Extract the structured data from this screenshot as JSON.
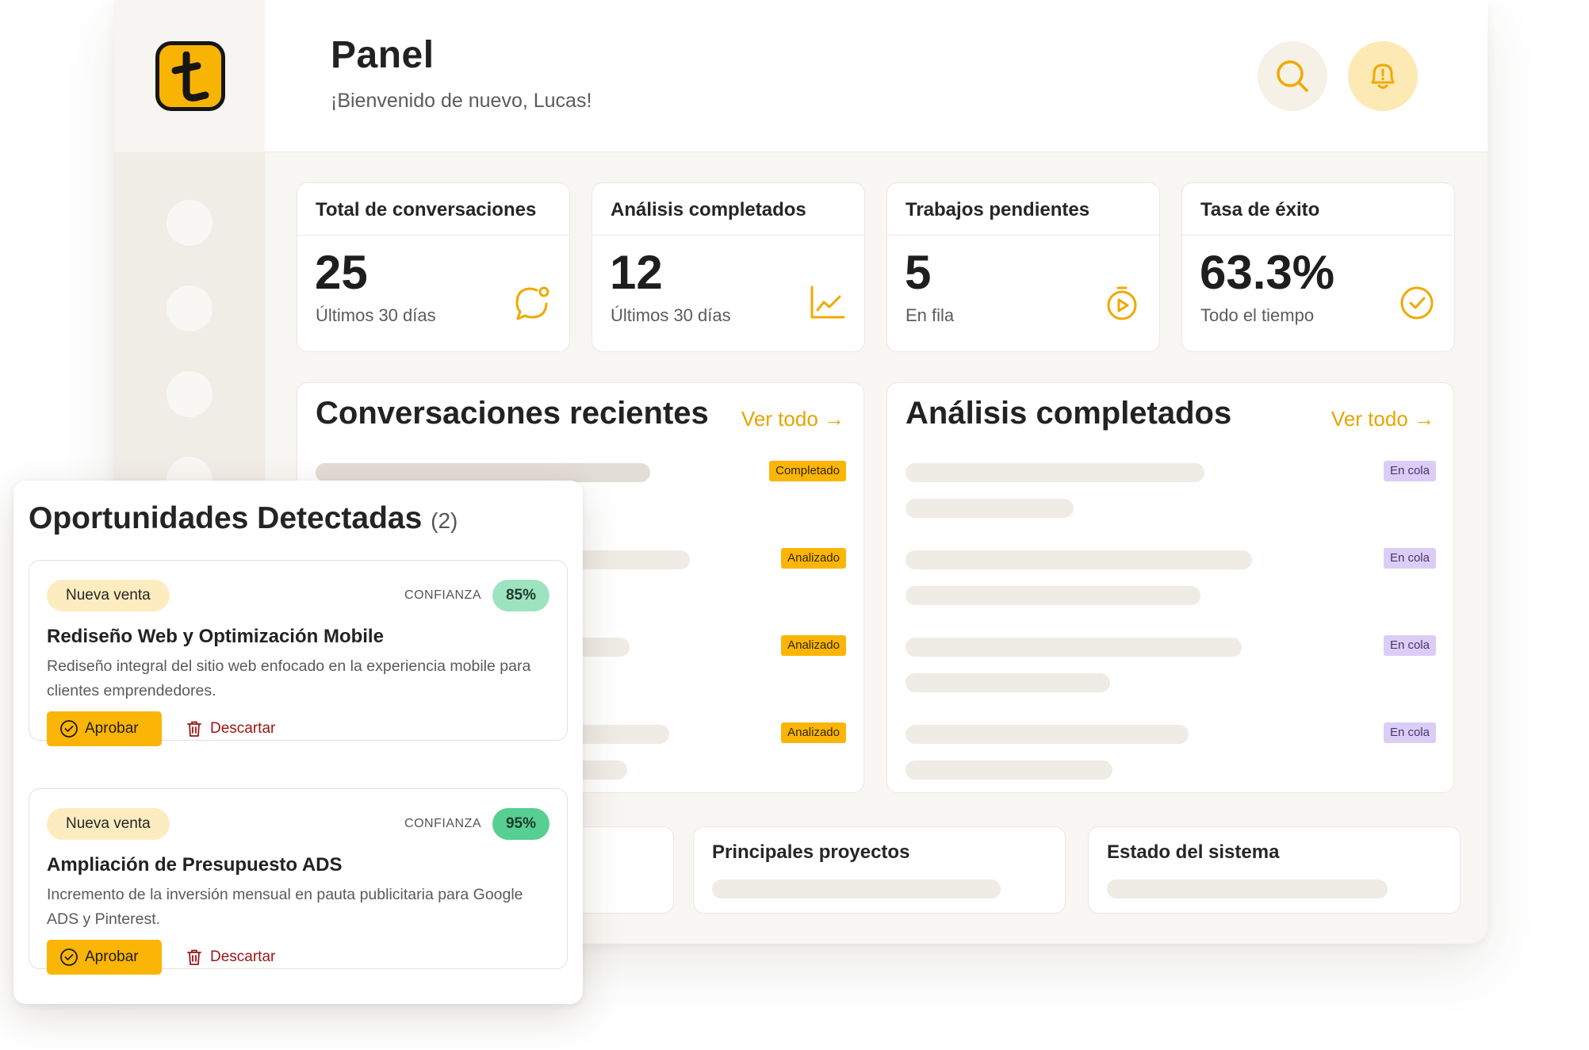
{
  "header": {
    "title": "Panel",
    "subtitle": "¡Bienvenido de nuevo, Lucas!",
    "search_icon": "search-icon",
    "bell_icon": "bell-icon"
  },
  "stats": [
    {
      "label": "Total de conversaciones",
      "value": "25",
      "sub": "Últimos 30 días",
      "icon": "chat-icon"
    },
    {
      "label": "Análisis completados",
      "value": "12",
      "sub": "Últimos 30 días",
      "icon": "chart-icon"
    },
    {
      "label": "Trabajos pendientes",
      "value": "5",
      "sub": "En fila",
      "icon": "timer-icon"
    },
    {
      "label": "Tasa de éxito",
      "value": "63.3%",
      "sub": "Todo el tiempo",
      "icon": "check-circle-icon"
    }
  ],
  "recent_conversations": {
    "title": "Conversaciones recientes",
    "link": "Ver todo →",
    "badges": [
      "Completado",
      "Analizado",
      "Analizado",
      "Analizado"
    ]
  },
  "completed_analyses": {
    "title": "Análisis completados",
    "link": "Ver todo →",
    "badges": [
      "En cola",
      "En cola",
      "En cola",
      "En cola"
    ]
  },
  "bottom_cards": {
    "projects_title": "Principales proyectos",
    "system_title": "Estado del sistema"
  },
  "opportunities": {
    "title": "Oportunidades Detectadas",
    "count": "(2)",
    "confidence_label": "CONFIANZA",
    "approve_label": "Aprobar",
    "discard_label": "Descartar",
    "items": [
      {
        "tag": "Nueva venta",
        "confidence": "85%",
        "name": "Rediseño Web y Optimización Mobile",
        "description": "Rediseño integral del sitio web enfocado en la experiencia mobile para clientes emprendedores."
      },
      {
        "tag": "Nueva venta",
        "confidence": "95%",
        "name": "Ampliación de Presupuesto ADS",
        "description": "Incremento de la inversión mensual en pauta publicitaria para Google ADS y Pinterest."
      }
    ]
  },
  "colors": {
    "accent": "#fbb507",
    "link": "#e7a400",
    "queued": "#dccdf7",
    "discard": "#9c1515",
    "confidence_mid": "#9de3c0",
    "confidence_high": "#57cf92"
  }
}
